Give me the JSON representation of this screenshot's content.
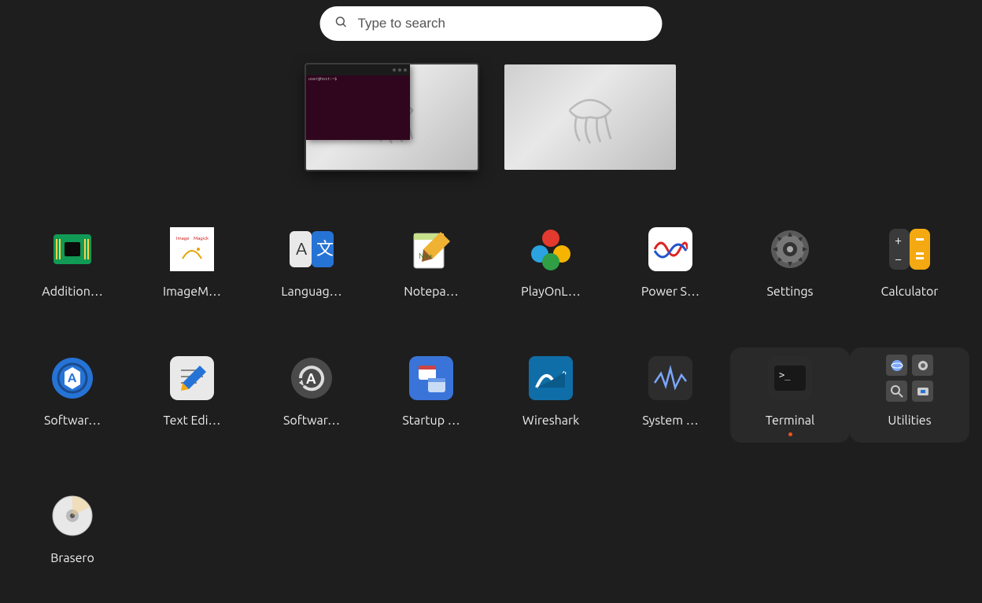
{
  "search": {
    "placeholder": "Type to search"
  },
  "workspaces": [
    {
      "active": true,
      "has_terminal": true
    },
    {
      "active": false,
      "has_terminal": false
    }
  ],
  "apps": [
    {
      "id": "additional-drivers",
      "label": "Addition…"
    },
    {
      "id": "imagemagick",
      "label": "ImageM…"
    },
    {
      "id": "language-support",
      "label": "Languag…"
    },
    {
      "id": "notepad-pp",
      "label": "Notepa…"
    },
    {
      "id": "playonlinux",
      "label": "PlayOnL…"
    },
    {
      "id": "power-statistics",
      "label": "Power S…"
    },
    {
      "id": "settings",
      "label": "Settings"
    },
    {
      "id": "calculator",
      "label": "Calculator"
    },
    {
      "id": "software-and-updates",
      "label": "Softwar…"
    },
    {
      "id": "text-editor",
      "label": "Text Edi…"
    },
    {
      "id": "software-updater",
      "label": "Softwar…"
    },
    {
      "id": "startup-apps",
      "label": "Startup …"
    },
    {
      "id": "wireshark",
      "label": "Wireshark"
    },
    {
      "id": "system-monitor",
      "label": "System …"
    },
    {
      "id": "terminal",
      "label": "Terminal",
      "highlight": true,
      "running": true
    },
    {
      "id": "utilities",
      "label": "Utilities",
      "highlight": true,
      "is_folder": true
    },
    {
      "id": "brasero",
      "label": "Brasero"
    }
  ]
}
